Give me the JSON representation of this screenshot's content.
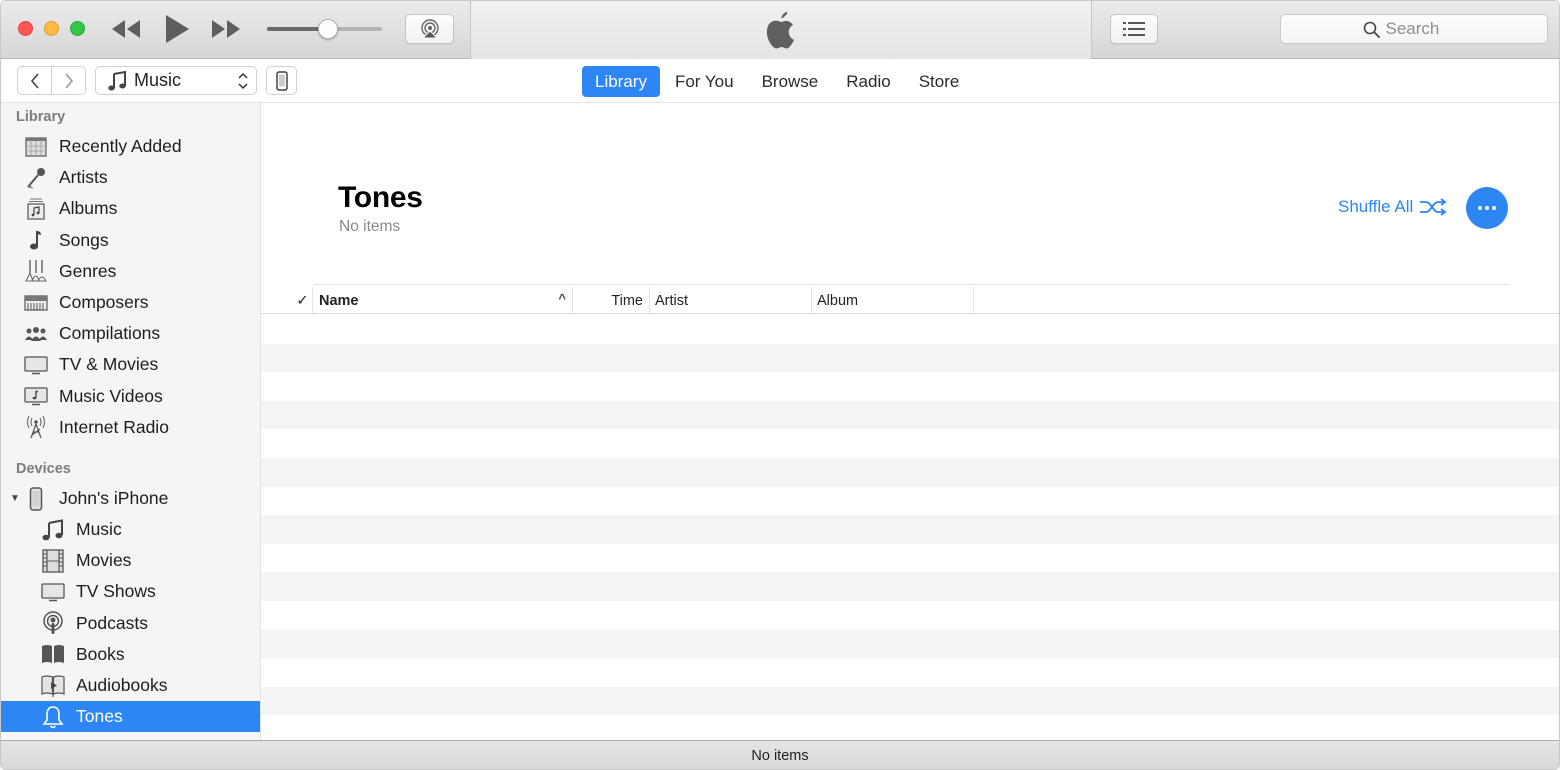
{
  "window": {
    "traffic_lights": [
      "close",
      "minimize",
      "zoom"
    ]
  },
  "toolbar": {
    "rewind_icon": "rewind-icon",
    "play_icon": "play-icon",
    "fast_forward_icon": "fast-forward-icon",
    "volume_level": 0.53,
    "airplay_icon": "airplay-icon",
    "lcd_icon": "apple-logo-icon",
    "up_next_icon": "list-icon",
    "search": {
      "placeholder": "Search",
      "value": ""
    }
  },
  "navbar": {
    "media_kind": "Music",
    "tabs": [
      {
        "label": "Library",
        "active": true
      },
      {
        "label": "For You",
        "active": false
      },
      {
        "label": "Browse",
        "active": false
      },
      {
        "label": "Radio",
        "active": false
      },
      {
        "label": "Store",
        "active": false
      }
    ]
  },
  "sidebar": {
    "library_heading": "Library",
    "library_items": [
      {
        "label": "Recently Added",
        "icon": "calendar-grid-icon"
      },
      {
        "label": "Artists",
        "icon": "microphone-icon"
      },
      {
        "label": "Albums",
        "icon": "album-stack-icon"
      },
      {
        "label": "Songs",
        "icon": "music-note-icon"
      },
      {
        "label": "Genres",
        "icon": "guitars-icon"
      },
      {
        "label": "Composers",
        "icon": "piano-keyboard-icon"
      },
      {
        "label": "Compilations",
        "icon": "people-group-icon"
      },
      {
        "label": "TV & Movies",
        "icon": "tv-icon"
      },
      {
        "label": "Music Videos",
        "icon": "music-video-icon"
      },
      {
        "label": "Internet Radio",
        "icon": "radio-tower-icon"
      }
    ],
    "devices_heading": "Devices",
    "device": {
      "label": "John's iPhone",
      "icon": "iphone-icon",
      "expanded": true
    },
    "device_items": [
      {
        "label": "Music",
        "icon": "music-notes-icon",
        "selected": false
      },
      {
        "label": "Movies",
        "icon": "film-strip-icon",
        "selected": false
      },
      {
        "label": "TV Shows",
        "icon": "tv-icon",
        "selected": false
      },
      {
        "label": "Podcasts",
        "icon": "podcast-icon",
        "selected": false
      },
      {
        "label": "Books",
        "icon": "book-icon",
        "selected": false
      },
      {
        "label": "Audiobooks",
        "icon": "audiobook-icon",
        "selected": false
      },
      {
        "label": "Tones",
        "icon": "bell-icon",
        "selected": true
      }
    ]
  },
  "main": {
    "title": "Tones",
    "subtitle": "No items",
    "shuffle_label": "Shuffle All",
    "table": {
      "columns": [
        {
          "key": "check",
          "label": "✓"
        },
        {
          "key": "name",
          "label": "Name",
          "sorted": "ascending",
          "sort_glyph": "^"
        },
        {
          "key": "time",
          "label": "Time"
        },
        {
          "key": "artist",
          "label": "Artist"
        },
        {
          "key": "album",
          "label": "Album"
        }
      ],
      "rows": []
    }
  },
  "statusbar": {
    "text": "No items"
  },
  "colors": {
    "accent": "#2d86f3",
    "close": "#fc5753",
    "minimize": "#fdbc40",
    "zoom": "#33c748",
    "row_alt": "#f4f4f4",
    "sidebar_bg": "#f5f5f5"
  }
}
